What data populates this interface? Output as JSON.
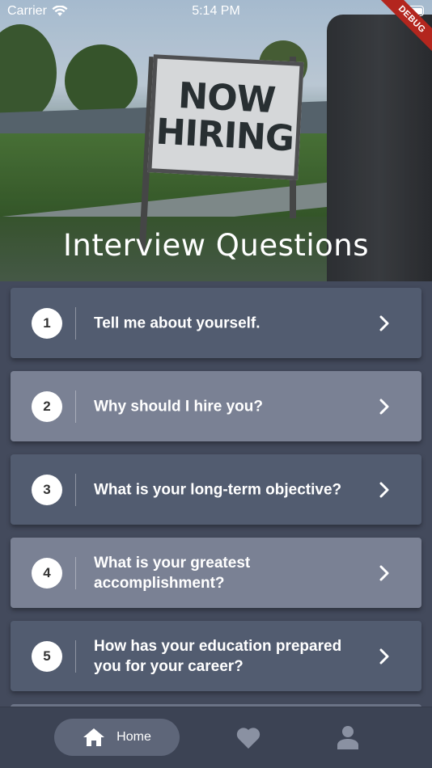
{
  "status_bar": {
    "carrier": "Carrier",
    "time": "5:14 PM",
    "debug": "DEBUG"
  },
  "header": {
    "title": "Interview Questions",
    "sign_line1": "NOW",
    "sign_line2": "HIRING"
  },
  "questions": [
    {
      "number": "1",
      "text": "Tell me about yourself.",
      "style": "dark"
    },
    {
      "number": "2",
      "text": "Why should I hire you?",
      "style": "light"
    },
    {
      "number": "3",
      "text": "What is your long-term objective?",
      "style": "dark"
    },
    {
      "number": "4",
      "text": "What is your greatest accomplishment?",
      "style": "light"
    },
    {
      "number": "5",
      "text": "How has your education prepared you for your career?",
      "style": "dark"
    }
  ],
  "bottom_nav": {
    "home_label": "Home",
    "items": [
      "home-icon",
      "heart-icon",
      "person-icon"
    ]
  },
  "colors": {
    "background": "#434a5c",
    "card_dark": "#525c70",
    "card_light": "#7a8194",
    "nav_bg": "#3c4354",
    "nav_active": "#5e6679",
    "debug_banner": "#b3261e"
  }
}
